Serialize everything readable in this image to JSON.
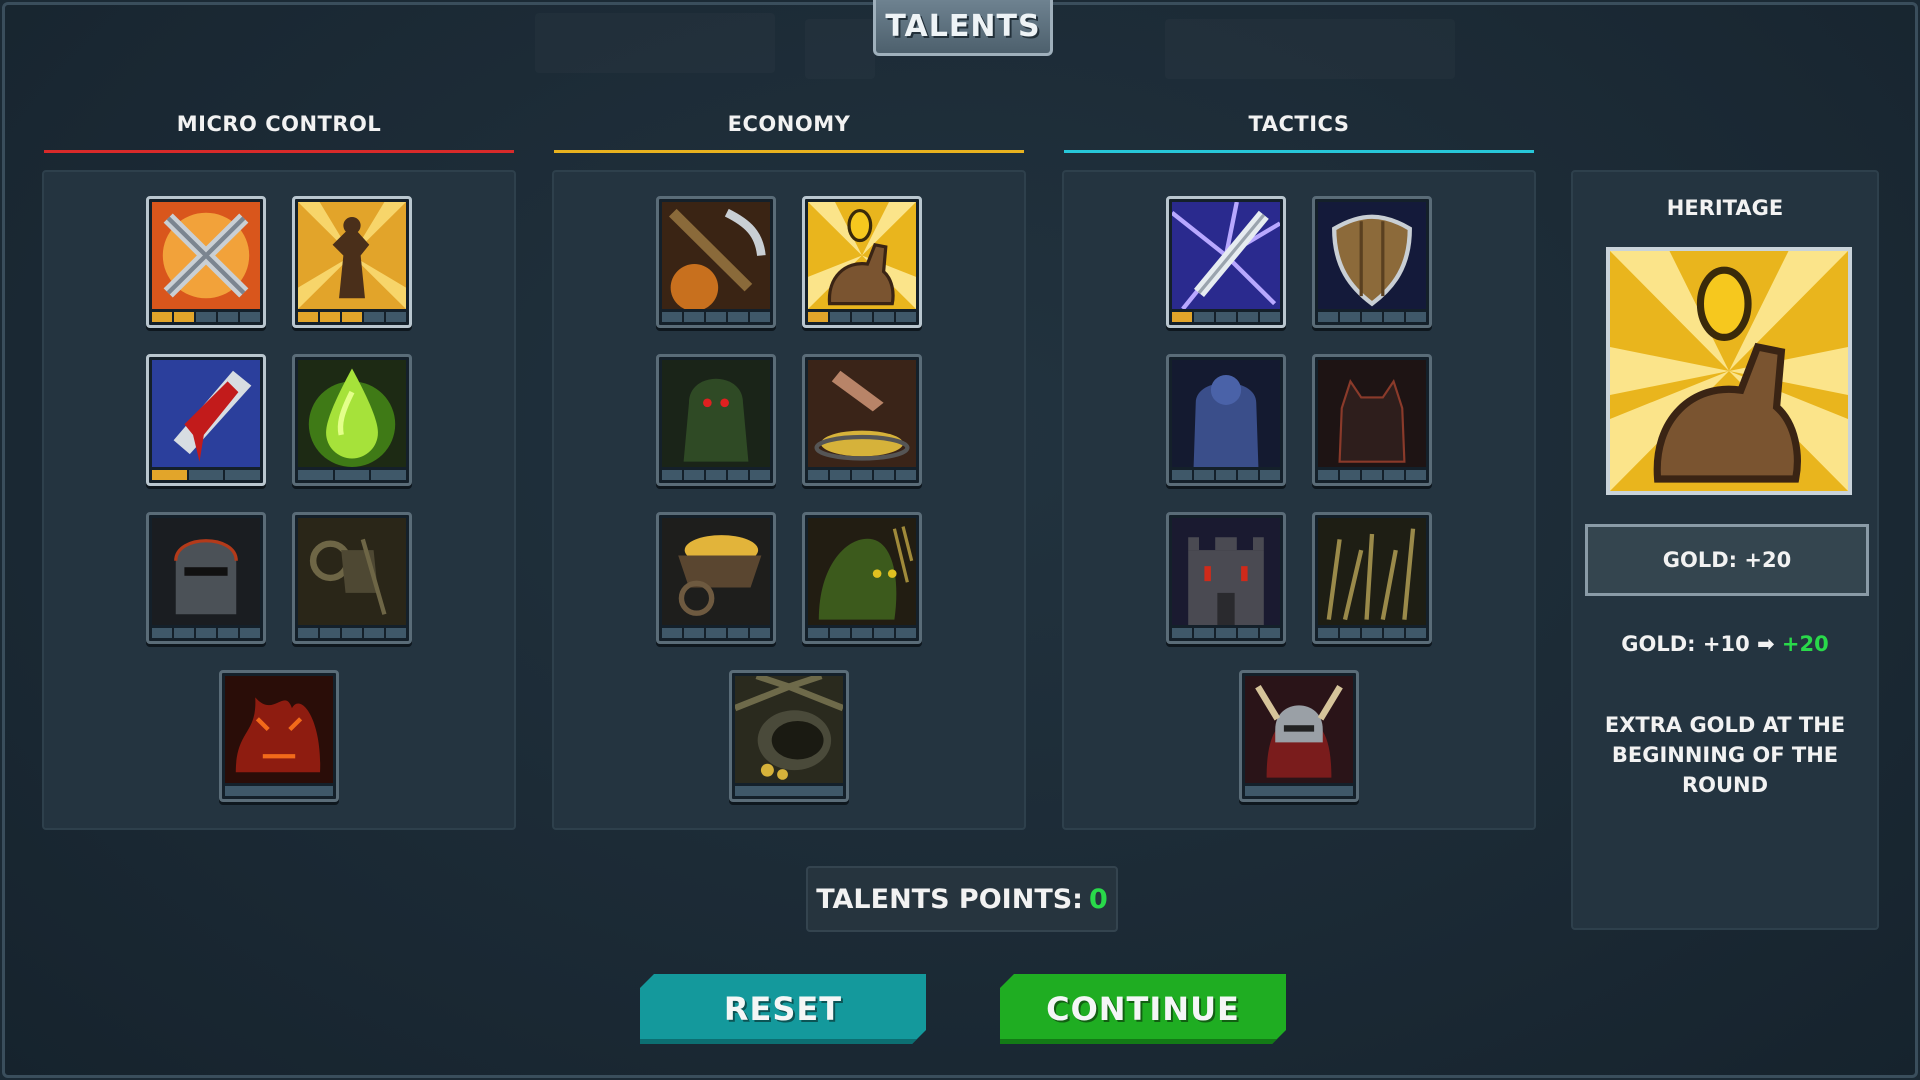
{
  "window": {
    "title": "TALENTS"
  },
  "columns": [
    {
      "name": "MICRO CONTROL",
      "accent": "#d82a2a"
    },
    {
      "name": "ECONOMY",
      "accent": "#e8b21f"
    },
    {
      "name": "TACTICS",
      "accent": "#27c7d9"
    }
  ],
  "talents": {
    "micro_control": [
      {
        "icon": "crossed-swords-icon",
        "level": 2,
        "max": 5
      },
      {
        "icon": "burst-warrior-icon",
        "level": 3,
        "max": 5
      },
      {
        "icon": "bleeding-blade-icon",
        "level": 1,
        "max": 3
      },
      {
        "icon": "poison-drop-icon",
        "level": 0,
        "max": 3
      },
      {
        "icon": "knight-helmet-icon",
        "level": 0,
        "max": 5
      },
      {
        "icon": "ram-skull-icon",
        "level": 0,
        "max": 5
      },
      {
        "icon": "fire-demon-icon",
        "level": 0,
        "max": 1
      }
    ],
    "economy": [
      {
        "icon": "pickaxe-icon",
        "level": 0,
        "max": 5
      },
      {
        "icon": "coin-flip-icon",
        "level": 1,
        "max": 5
      },
      {
        "icon": "hooded-thief-icon",
        "level": 0,
        "max": 5
      },
      {
        "icon": "gold-tray-icon",
        "level": 0,
        "max": 5
      },
      {
        "icon": "gold-cart-icon",
        "level": 0,
        "max": 5
      },
      {
        "icon": "goblin-hoard-icon",
        "level": 0,
        "max": 5
      },
      {
        "icon": "treasure-pot-icon",
        "level": 0,
        "max": 1
      }
    ],
    "tactics": [
      {
        "icon": "lightning-sword-icon",
        "level": 1,
        "max": 5
      },
      {
        "icon": "wooden-shield-icon",
        "level": 0,
        "max": 5
      },
      {
        "icon": "ghost-spirit-icon",
        "level": 0,
        "max": 5
      },
      {
        "icon": "horned-demon-icon",
        "level": 0,
        "max": 5
      },
      {
        "icon": "castle-fortress-icon",
        "level": 0,
        "max": 5
      },
      {
        "icon": "spike-field-icon",
        "level": 0,
        "max": 5
      },
      {
        "icon": "horned-knight-icon",
        "level": 0,
        "max": 1
      }
    ]
  },
  "selected": {
    "title": "HERITAGE",
    "icon": "coin-flip-icon",
    "current_value": "GOLD: +20",
    "change_from": "GOLD: +10",
    "change_arrow": "➡",
    "change_to": "+20",
    "description": "EXTRA GOLD AT THE BEGINNING OF THE ROUND"
  },
  "points": {
    "label": "TALENTS POINTS:",
    "value": "0"
  },
  "buttons": {
    "reset": "RESET",
    "continue": "CONTINUE"
  }
}
